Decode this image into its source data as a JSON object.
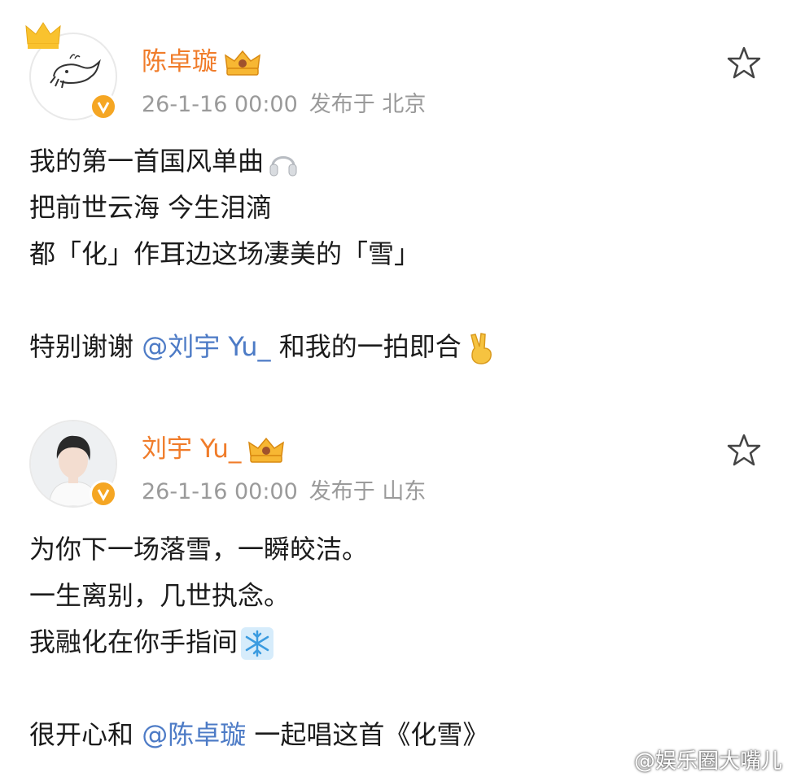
{
  "posts": [
    {
      "author": "陈卓璇",
      "date": "26-1-16 00:00",
      "location": "发布于 北京",
      "lines": [
        {
          "text": "我的第一首国风单曲",
          "emoji": "headphones-icon"
        },
        {
          "text": "把前世云海 今生泪滴"
        },
        {
          "text": "都「化」作耳边这场凄美的「雪」"
        },
        {
          "text": ""
        },
        {
          "before": "特别谢谢 ",
          "mention": "@刘宇 Yu_",
          "after": " 和我的一拍即合",
          "emoji": "victory-hand-icon"
        }
      ]
    },
    {
      "author": "刘宇 Yu_",
      "date": "26-1-16 00:00",
      "location": "发布于 山东",
      "lines": [
        {
          "text": "为你下一场落雪，一瞬皎洁。"
        },
        {
          "text": "一生离别，几世执念。"
        },
        {
          "text": "我融化在你手指间",
          "emoji": "snowflake-icon"
        },
        {
          "text": ""
        },
        {
          "before": "很开心和 ",
          "mention": "@陈卓璇",
          "after": " 一起唱这首《化雪》"
        }
      ]
    }
  ],
  "watermark": "@娱乐圈大嘴儿",
  "colors": {
    "name": "#f07c2a",
    "meta": "#9a9a9a",
    "mention": "#4d7bc6",
    "verified": "#f5a623"
  }
}
